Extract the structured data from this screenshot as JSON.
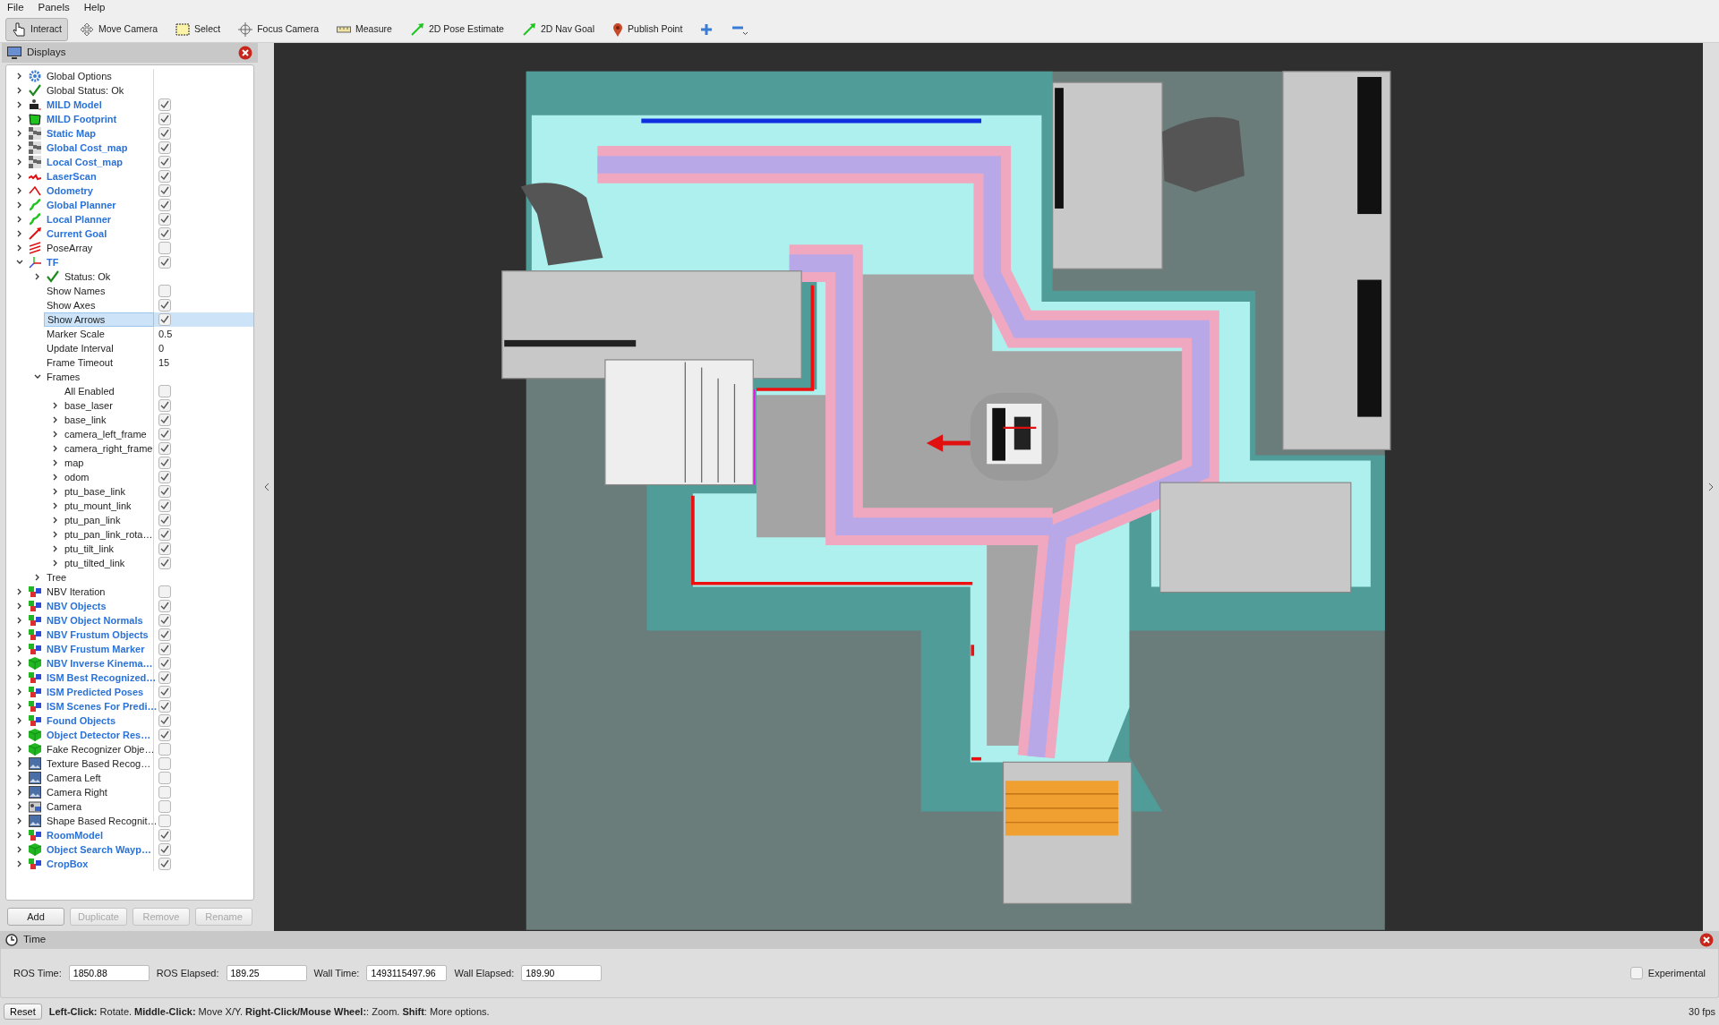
{
  "menu": [
    "File",
    "Panels",
    "Help"
  ],
  "toolbar": [
    {
      "kind": "hand",
      "label": "Interact",
      "selected": true
    },
    {
      "kind": "move",
      "label": "Move Camera",
      "selected": false
    },
    {
      "kind": "select",
      "label": "Select",
      "selected": false
    },
    {
      "kind": "focus",
      "label": "Focus Camera",
      "selected": false
    },
    {
      "kind": "measure",
      "label": "Measure",
      "selected": false
    },
    {
      "kind": "pose",
      "label": "2D Pose Estimate",
      "selected": false
    },
    {
      "kind": "nav",
      "label": "2D Nav Goal",
      "selected": false
    },
    {
      "kind": "pin",
      "label": "Publish Point",
      "selected": false
    },
    {
      "kind": "plus",
      "selected": false
    },
    {
      "kind": "minus",
      "selected": false
    }
  ],
  "displays_panel": {
    "title": "Displays",
    "items": [
      {
        "label": "Global Options",
        "kind": "gear",
        "expanded": false,
        "selected": false
      },
      {
        "label": "Global Status: Ok",
        "kind": "check",
        "expanded": false,
        "selected": false
      },
      {
        "label": "MILD Model",
        "kind": "robot",
        "expanded": false,
        "checked": true,
        "selected": false
      },
      {
        "label": "MILD Footprint",
        "kind": "footprint",
        "expanded": false,
        "checked": true,
        "selected": false
      },
      {
        "label": "Static Map",
        "kind": "grid",
        "expanded": false,
        "checked": true,
        "selected": false
      },
      {
        "label": "Global Cost_map",
        "kind": "grid",
        "expanded": false,
        "checked": true,
        "selected": false
      },
      {
        "label": "Local Cost_map",
        "kind": "grid",
        "expanded": false,
        "checked": true,
        "selected": false
      },
      {
        "label": "LaserScan",
        "kind": "laser",
        "expanded": false,
        "checked": true,
        "selected": false
      },
      {
        "label": "Odometry",
        "kind": "odometry",
        "expanded": false,
        "checked": true,
        "selected": false
      },
      {
        "label": "Global Planner",
        "kind": "path",
        "expanded": false,
        "checked": true,
        "selected": false
      },
      {
        "label": "Local Planner",
        "kind": "path",
        "expanded": false,
        "checked": true,
        "selected": false
      },
      {
        "label": "Current Goal",
        "kind": "goal",
        "expanded": false,
        "checked": true,
        "selected": false
      },
      {
        "label": "PoseArray",
        "kind": "poses",
        "expanded": false,
        "checked": false,
        "selected": false
      },
      {
        "label": "TF",
        "kind": "axes",
        "expanded": true,
        "checked": true,
        "selected": false,
        "children": [
          {
            "label": "Status: Ok",
            "kind": "check",
            "expanded": false,
            "selected": false
          },
          {
            "label": "Show Names",
            "kind": "property",
            "checked": false,
            "selected": false
          },
          {
            "label": "Show Axes",
            "kind": "property",
            "checked": true,
            "selected": false
          },
          {
            "label": "Show Arrows",
            "kind": "property",
            "checked": true,
            "selected": true
          },
          {
            "label": "Marker Scale",
            "kind": "property",
            "value": "0.5",
            "selected": false
          },
          {
            "label": "Update Interval",
            "kind": "property",
            "value": "0",
            "selected": false
          },
          {
            "label": "Frame Timeout",
            "kind": "property",
            "value": "15",
            "selected": false
          },
          {
            "label": "Frames",
            "kind": "property",
            "expanded": true,
            "selected": false,
            "children": [
              {
                "label": "All Enabled",
                "kind": "property",
                "checked": false,
                "selected": false
              },
              {
                "label": "base_laser",
                "kind": "property",
                "expanded": false,
                "checked": true,
                "selected": false
              },
              {
                "label": "base_link",
                "kind": "property",
                "expanded": false,
                "checked": true,
                "selected": false
              },
              {
                "label": "camera_left_frame",
                "kind": "property",
                "expanded": false,
                "checked": true,
                "selected": false
              },
              {
                "label": "camera_right_frame",
                "kind": "property",
                "expanded": false,
                "checked": true,
                "selected": false
              },
              {
                "label": "map",
                "kind": "property",
                "expanded": false,
                "checked": true,
                "selected": false
              },
              {
                "label": "odom",
                "kind": "property",
                "expanded": false,
                "checked": true,
                "selected": false
              },
              {
                "label": "ptu_base_link",
                "kind": "property",
                "expanded": false,
                "checked": true,
                "selected": false
              },
              {
                "label": "ptu_mount_link",
                "kind": "property",
                "expanded": false,
                "checked": true,
                "selected": false
              },
              {
                "label": "ptu_pan_link",
                "kind": "property",
                "expanded": false,
                "checked": true,
                "selected": false
              },
              {
                "label": "ptu_pan_link_rota…",
                "kind": "property",
                "expanded": false,
                "checked": true,
                "selected": false
              },
              {
                "label": "ptu_tilt_link",
                "kind": "property",
                "expanded": false,
                "checked": true,
                "selected": false
              },
              {
                "label": "ptu_tilted_link",
                "kind": "property",
                "expanded": false,
                "checked": true,
                "selected": false
              }
            ]
          },
          {
            "label": "Tree",
            "kind": "property",
            "expanded": false,
            "selected": false
          }
        ]
      },
      {
        "label": "NBV Iteration",
        "kind": "markers",
        "expanded": false,
        "checked": false,
        "selected": false
      },
      {
        "label": "NBV Objects",
        "kind": "markers",
        "expanded": false,
        "checked": true,
        "selected": false
      },
      {
        "label": "NBV Object Normals",
        "kind": "markers",
        "expanded": false,
        "checked": true,
        "selected": false
      },
      {
        "label": "NBV Frustum Objects",
        "kind": "markers",
        "expanded": false,
        "checked": true,
        "selected": false
      },
      {
        "label": "NBV Frustum Marker",
        "kind": "markers",
        "expanded": false,
        "checked": true,
        "selected": false
      },
      {
        "label": "NBV Inverse Kinema…",
        "kind": "cube",
        "expanded": false,
        "checked": true,
        "selected": false
      },
      {
        "label": "ISM Best Recognized…",
        "kind": "markers",
        "expanded": false,
        "checked": true,
        "selected": false
      },
      {
        "label": "ISM Predicted Poses",
        "kind": "markers",
        "expanded": false,
        "checked": true,
        "selected": false
      },
      {
        "label": "ISM Scenes For Predi…",
        "kind": "markers",
        "expanded": false,
        "checked": true,
        "selected": false
      },
      {
        "label": "Found Objects",
        "kind": "markers",
        "expanded": false,
        "checked": true,
        "selected": false
      },
      {
        "label": "Object Detector Res…",
        "kind": "cube",
        "expanded": false,
        "checked": true,
        "selected": false
      },
      {
        "label": "Fake Recognizer Obje…",
        "kind": "cube",
        "expanded": false,
        "checked": false,
        "selected": false
      },
      {
        "label": "Texture Based Recog…",
        "kind": "image",
        "expanded": false,
        "checked": false,
        "selected": false
      },
      {
        "label": "Camera Left",
        "kind": "image",
        "expanded": false,
        "checked": false,
        "selected": false
      },
      {
        "label": "Camera Right",
        "kind": "image",
        "expanded": false,
        "checked": false,
        "selected": false
      },
      {
        "label": "Camera",
        "kind": "camera",
        "expanded": false,
        "checked": false,
        "selected": false
      },
      {
        "label": "Shape Based Recognit…",
        "kind": "image",
        "expanded": false,
        "checked": false,
        "selected": false
      },
      {
        "label": "RoomModel",
        "kind": "markers",
        "expanded": false,
        "checked": true,
        "selected": false
      },
      {
        "label": "Object Search Wayp…",
        "kind": "cube",
        "expanded": false,
        "checked": true,
        "selected": false
      },
      {
        "label": "CropBox",
        "kind": "markers",
        "expanded": false,
        "checked": true,
        "selected": false
      }
    ],
    "buttons": [
      {
        "label": "Add",
        "disabled": false
      },
      {
        "label": "Duplicate",
        "disabled": true
      },
      {
        "label": "Remove",
        "disabled": true
      },
      {
        "label": "Rename",
        "disabled": true
      }
    ]
  },
  "time_panel": {
    "title": "Time",
    "fields": [
      {
        "label": "ROS Time:",
        "value": "1850.88"
      },
      {
        "label": "ROS Elapsed:",
        "value": "189.25"
      },
      {
        "label": "Wall Time:",
        "value": "1493115497.96"
      },
      {
        "label": "Wall Elapsed:",
        "value": "189.90"
      }
    ],
    "experimental": {
      "label": "Experimental",
      "checked": false
    }
  },
  "status_bar": {
    "reset": "Reset",
    "hint": "**Left-Click:** Rotate. **Middle-Click:** Move X/Y. **Right-Click/Mouse Wheel:**: Zoom. **Shift**: More options.",
    "fps": "30 fps"
  }
}
